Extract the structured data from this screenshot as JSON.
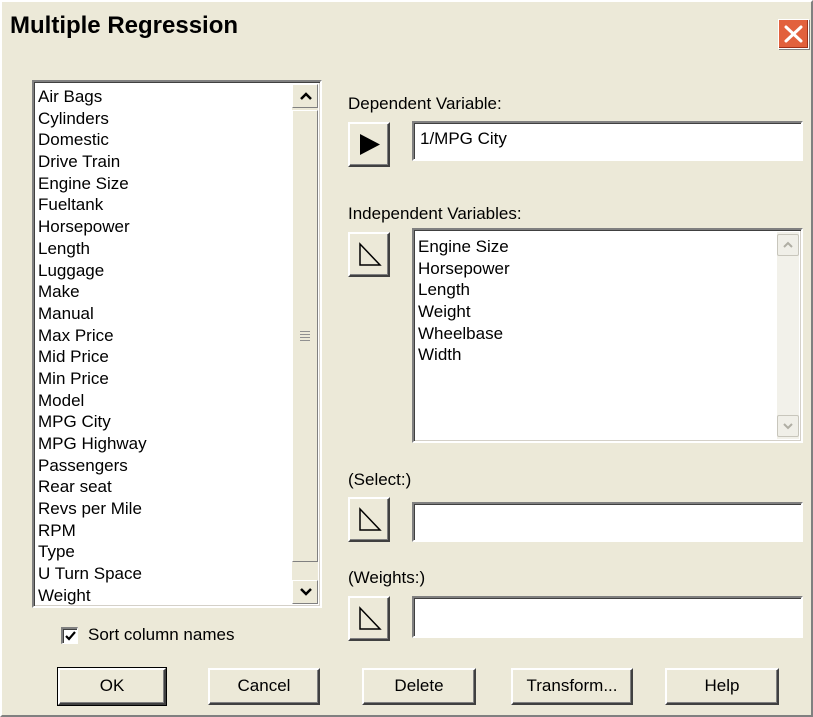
{
  "window": {
    "title": "Multiple Regression"
  },
  "variables": {
    "items": [
      "Air Bags",
      "Cylinders",
      "Domestic",
      "Drive Train",
      "Engine Size",
      "Fueltank",
      "Horsepower",
      "Length",
      "Luggage",
      "Make",
      "Manual",
      "Max Price",
      "Mid Price",
      "Min Price",
      "Model",
      "MPG City",
      "MPG Highway",
      "Passengers",
      "Rear seat",
      "Revs per Mile",
      "RPM",
      "Type",
      "U Turn Space",
      "Weight"
    ]
  },
  "dependent": {
    "label": "Dependent Variable:",
    "value": "1/MPG City"
  },
  "independent": {
    "label": "Independent Variables:",
    "items": [
      "Engine Size",
      "Horsepower",
      "Length",
      "Weight",
      "Wheelbase",
      "Width"
    ]
  },
  "select": {
    "label": "(Select:)",
    "value": ""
  },
  "weights": {
    "label": "(Weights:)",
    "value": ""
  },
  "sort": {
    "label": "Sort column names",
    "checked": true
  },
  "buttons": {
    "ok": "OK",
    "cancel": "Cancel",
    "delete": "Delete",
    "transform": "Transform...",
    "help": "Help"
  },
  "icons": {
    "close": "close-icon",
    "arrow_filled": "play-right-filled-icon",
    "arrow_outline": "play-right-outline-icon"
  },
  "colors": {
    "close_button": "#e2613d",
    "dialog_bg": "#ece9d8"
  }
}
